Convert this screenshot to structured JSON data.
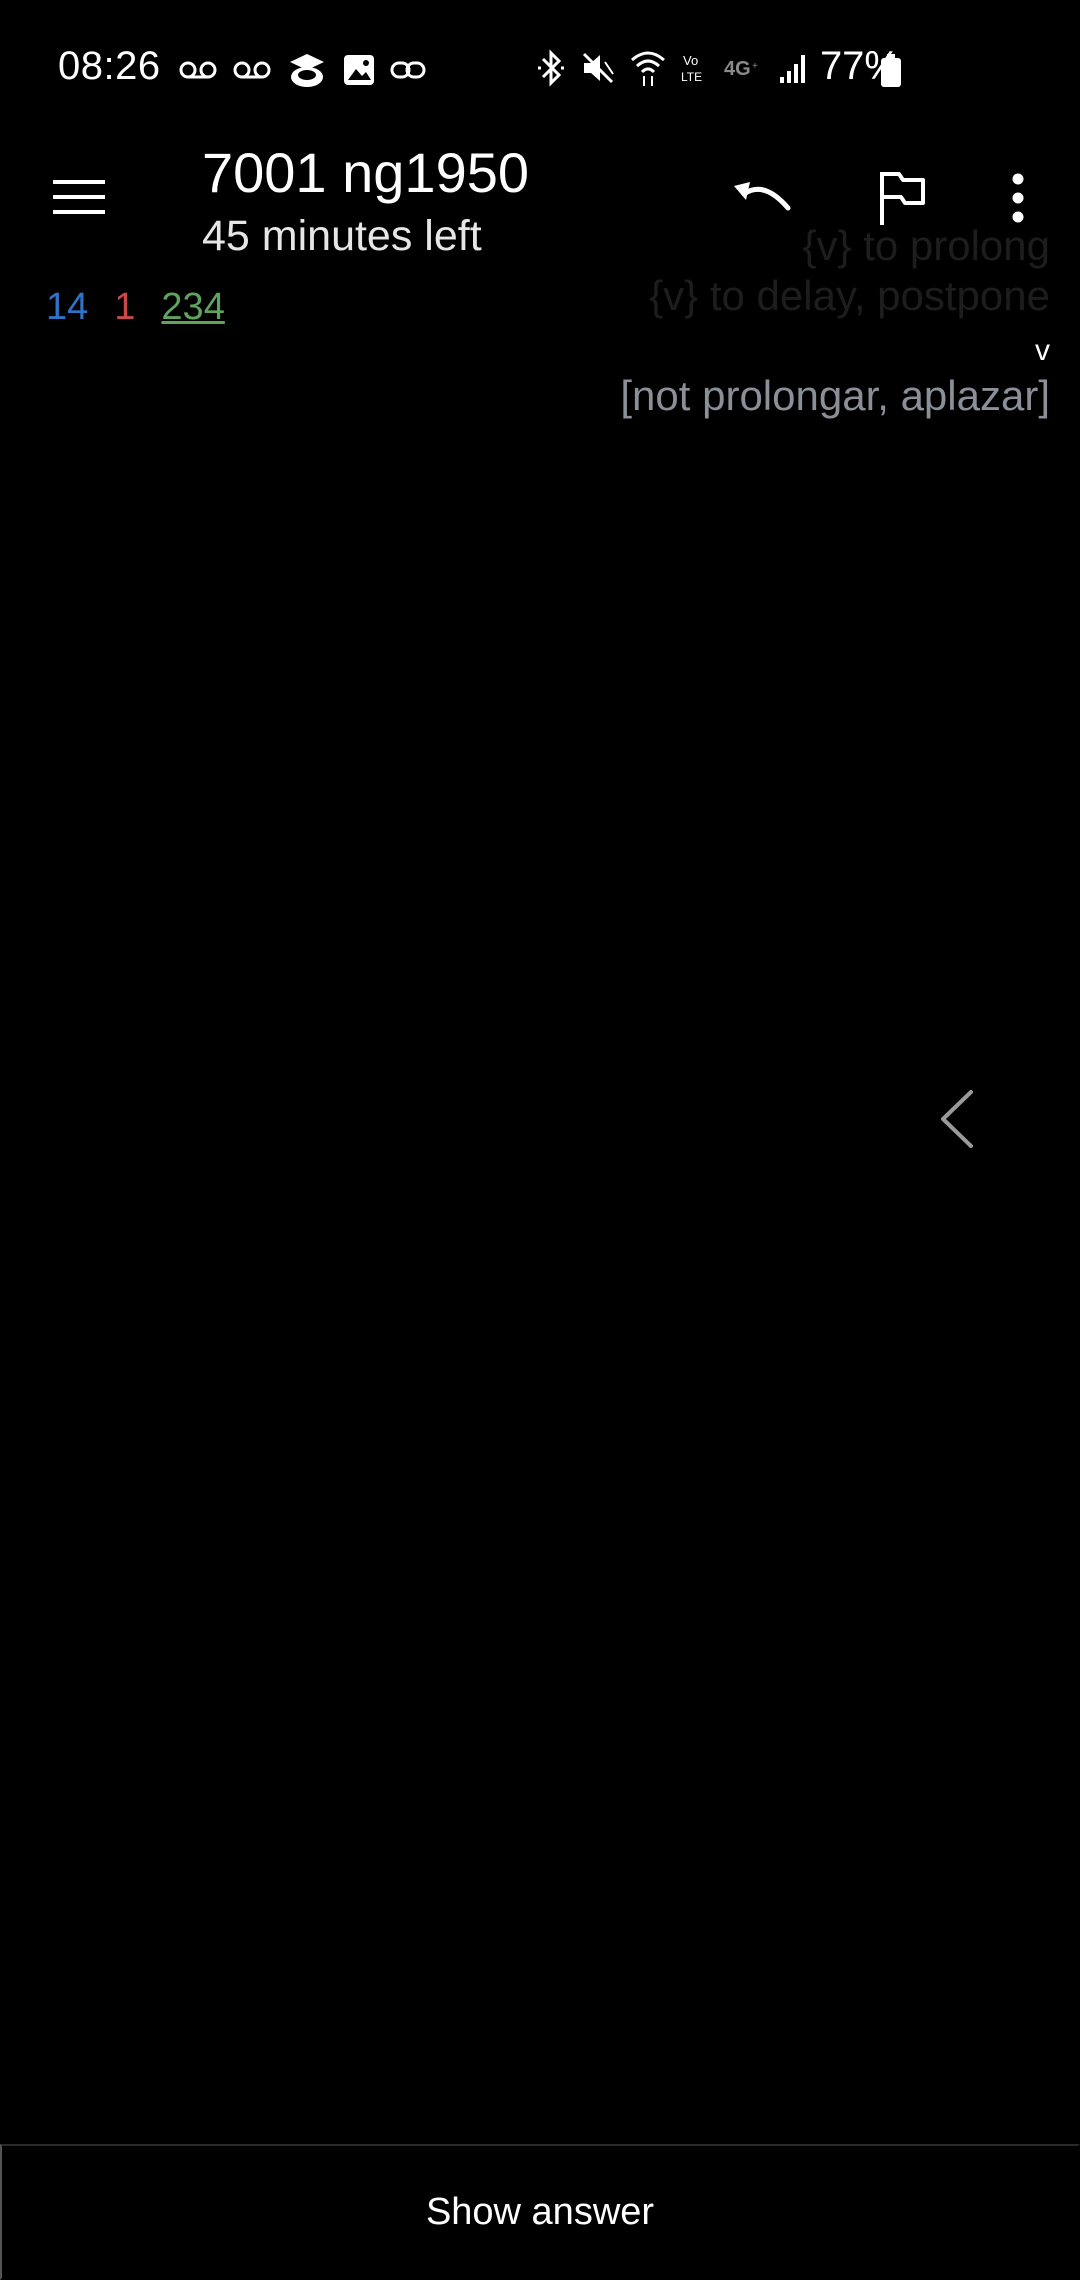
{
  "status_bar": {
    "time": "08:26",
    "battery_percent": "77%",
    "left_icons": [
      "voicemail-icon",
      "voicemail-icon",
      "app-notification-icon",
      "image-icon",
      "link-icon"
    ],
    "right_icons": [
      "bluetooth-icon",
      "mute-icon",
      "wifi-icon",
      "volte-icon",
      "4g-icon",
      "signal-icon",
      "battery-icon"
    ]
  },
  "toolbar": {
    "title": "7001 ng1950",
    "subtitle": "45 minutes left",
    "icons": [
      "menu-icon",
      "undo-icon",
      "flag-icon",
      "more-vert-icon"
    ]
  },
  "counts": {
    "new": "14",
    "learning": "1",
    "review": "234"
  },
  "card": {
    "line1": "{v} to prolong",
    "line2": "{v} to delay, postpone",
    "line3": "v",
    "line4": "[not prolongar, aplazar]"
  },
  "bottom": {
    "show_answer_label": "Show answer"
  },
  "colors": {
    "background": "#000000",
    "new_count": "#2f73c7",
    "learning_count": "#c94848",
    "review_count": "#5fa35f",
    "hint_text": "#8a8f98"
  }
}
